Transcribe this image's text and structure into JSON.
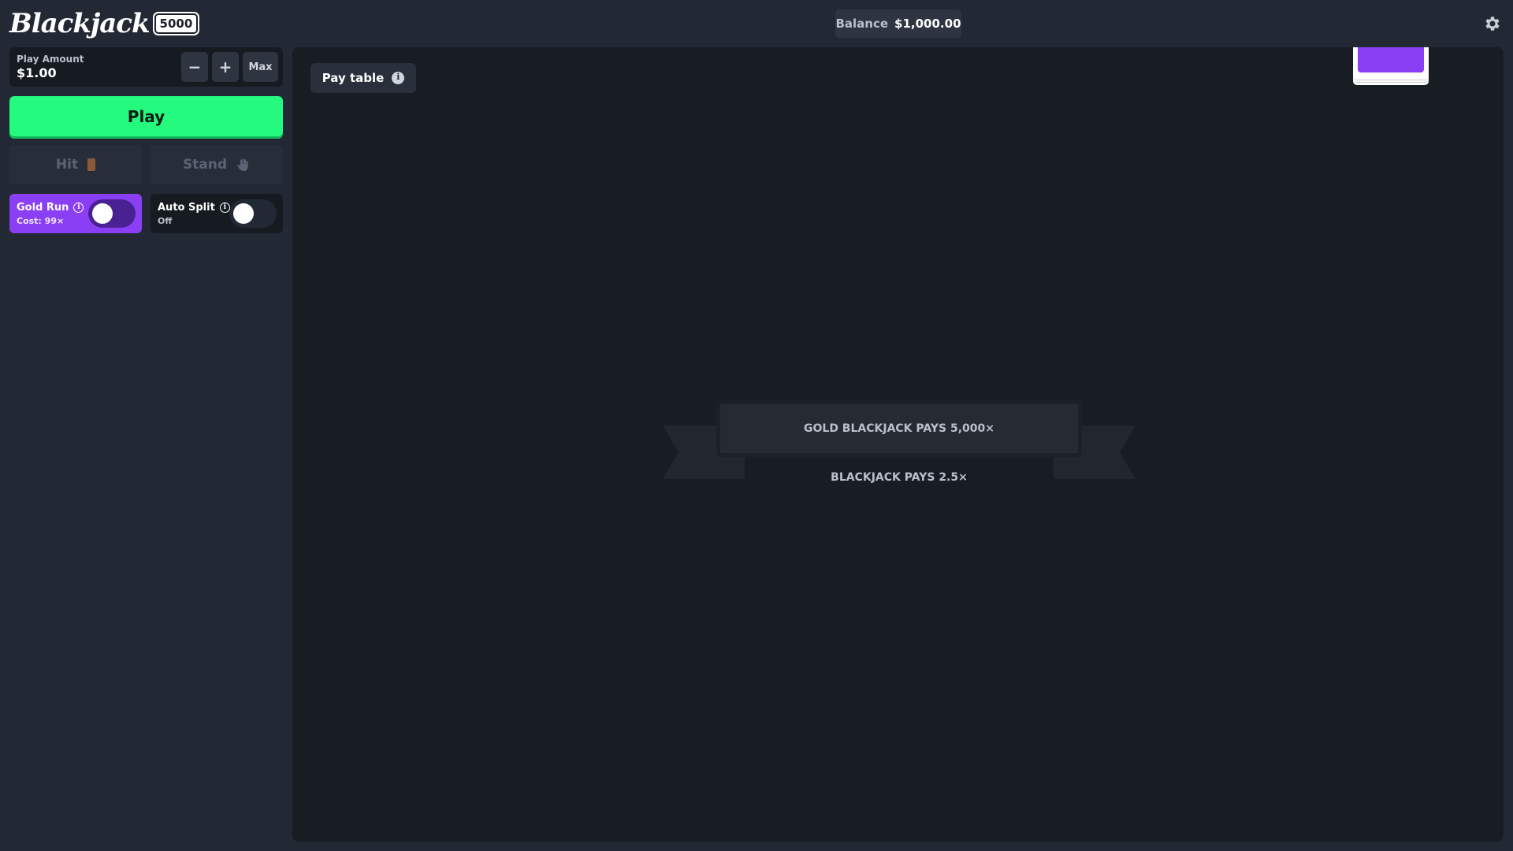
{
  "header": {
    "logo_text": "Blackjack",
    "logo_badge": "5000",
    "balance_label": "Balance",
    "balance_value": "$1,000.00",
    "settings_icon": "gear-icon"
  },
  "sidebar": {
    "play_amount": {
      "label": "Play Amount",
      "value": "$1.00",
      "minus_label": "−",
      "plus_label": "+",
      "max_label": "Max"
    },
    "play_label": "Play",
    "hit_label": "Hit",
    "stand_label": "Stand",
    "gold_run": {
      "title": "Gold Run",
      "subtitle": "Cost: 99×",
      "enabled": false
    },
    "auto_split": {
      "title": "Auto Split",
      "subtitle": "Off",
      "enabled": false
    }
  },
  "table": {
    "paytable_label": "Pay table",
    "gold_blackjack_text": "GOLD BLACKJACK PAYS 5,000×",
    "blackjack_text": "BLACKJACK PAYS 2.5×"
  },
  "colors": {
    "accent_green": "#24fa7d",
    "accent_purple": "#8b3ff5",
    "background": "#232934",
    "table": "#181c23"
  }
}
